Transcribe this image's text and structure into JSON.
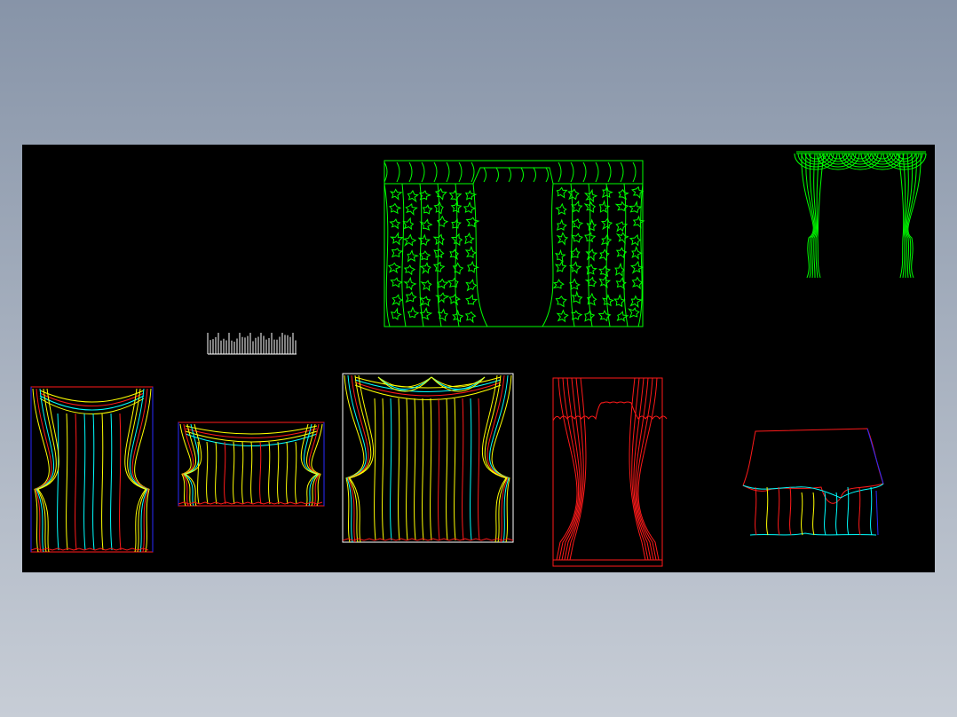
{
  "canvas": {
    "background": "#000000"
  },
  "palette": {
    "green": "#00ff00",
    "red": "#ff1a1a",
    "yellow": "#ffff00",
    "cyan": "#00ffff",
    "blue": "#2a2aff",
    "white": "#ffffff"
  },
  "drawings": [
    "patterned-star-curtain",
    "swag-valance-curtain-green",
    "small-text-strip",
    "theatre-curtain-left",
    "valance-curtain-small",
    "theatre-curtain-large",
    "red-drape-curtain",
    "table-cloth-drape"
  ]
}
